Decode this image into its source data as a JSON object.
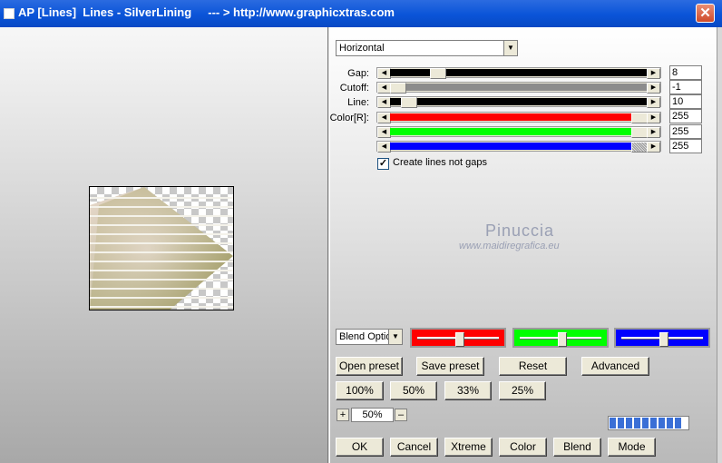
{
  "titlebar": {
    "title": "AP [Lines]  Lines - SilverLining     --- > http://www.graphicxtras.com",
    "close_label": "✕"
  },
  "direction": {
    "value": "Horizontal"
  },
  "params": [
    {
      "label": "Gap:",
      "value": "8",
      "fill": "black",
      "position": 0.18
    },
    {
      "label": "Cutoff:",
      "value": "-1",
      "fill": "gray",
      "position": 0.0
    },
    {
      "label": "Line:",
      "value": "10",
      "fill": "black",
      "position": 0.06
    },
    {
      "label": "Color[R]:",
      "value": "255",
      "fill": "red",
      "position": 1.0
    },
    {
      "label": "",
      "value": "255",
      "fill": "green",
      "position": 1.0
    },
    {
      "label": "",
      "value": "255",
      "fill": "blue",
      "position": 1.0
    }
  ],
  "checkbox": {
    "label": "Create lines not gaps",
    "checked": true,
    "mark": "✓"
  },
  "watermark": {
    "line1": "Pinuccia",
    "line2": "www.maidiregrafica.eu"
  },
  "blend": {
    "value": "Blend Optio"
  },
  "color_sliders": [
    {
      "color": "#ff0000",
      "position": 0.5
    },
    {
      "color": "#00ff00",
      "position": 0.5
    },
    {
      "color": "#0000ff",
      "position": 0.5
    }
  ],
  "buttons_row1": [
    "Open preset",
    "Save preset",
    "Reset",
    "Advanced"
  ],
  "zoom_buttons": [
    "100%",
    "50%",
    "33%",
    "25%"
  ],
  "zoom": {
    "plus": "+",
    "value": "50%",
    "minus": "–"
  },
  "progress": {
    "filled_cells": 9,
    "total_cells": 9
  },
  "bottom_buttons": [
    "OK",
    "Cancel",
    "Xtreme",
    "Color",
    "Blend",
    "Mode"
  ]
}
